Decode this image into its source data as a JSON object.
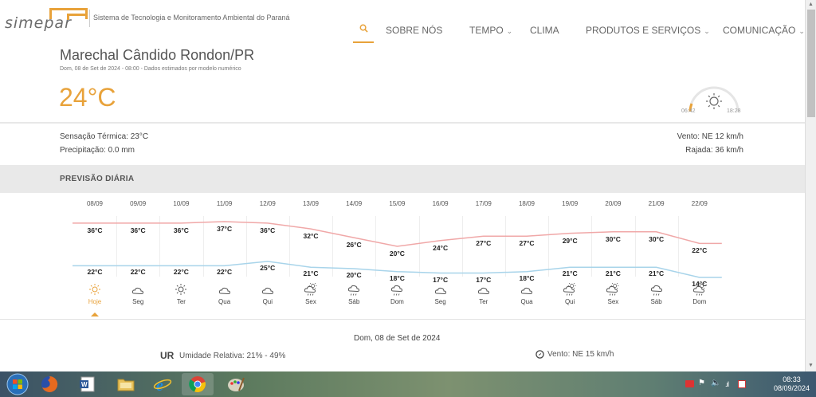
{
  "header": {
    "logo_text": "simepar",
    "subtitle": "Sistema de Tecnologia e Monitoramento Ambiental do Paraná",
    "nav": [
      {
        "label": "SOBRE NÓS",
        "dropdown": false
      },
      {
        "label": "TEMPO",
        "dropdown": true
      },
      {
        "label": "CLIMA",
        "dropdown": false
      },
      {
        "label": "PRODUTOS E SERVIÇOS",
        "dropdown": true
      },
      {
        "label": "COMUNICAÇÃO",
        "dropdown": true
      }
    ],
    "search_icon": "search-icon"
  },
  "current": {
    "city": "Marechal Cândido Rondon/PR",
    "date_note": "Dom, 08 de Set de 2024 - 08:00 - Dados estimados por modelo numérico",
    "temperature": "24°C",
    "sunrise": "06:42",
    "sunset": "18:28",
    "feels_like": "Sensação Térmica: 23°C",
    "precipitation": "Precipitação: 0.0 mm",
    "wind": "Vento: NE 12 km/h",
    "gust": "Rajada: 36 km/h"
  },
  "forecast": {
    "title": "PREVISÃO DIÁRIA",
    "days": [
      {
        "date": "08/09",
        "max": "36°C",
        "min": "22°C",
        "day": "Hoje",
        "icon": "sun-icon"
      },
      {
        "date": "09/09",
        "max": "36°C",
        "min": "22°C",
        "day": "Seg",
        "icon": "partly-cloudy-icon"
      },
      {
        "date": "10/09",
        "max": "36°C",
        "min": "22°C",
        "day": "Ter",
        "icon": "sun-icon"
      },
      {
        "date": "11/09",
        "max": "37°C",
        "min": "22°C",
        "day": "Qua",
        "icon": "partly-cloudy-icon"
      },
      {
        "date": "12/09",
        "max": "36°C",
        "min": "25°C",
        "day": "Qui",
        "icon": "partly-cloudy-icon"
      },
      {
        "date": "13/09",
        "max": "32°C",
        "min": "21°C",
        "day": "Sex",
        "icon": "sun-rain-icon"
      },
      {
        "date": "14/09",
        "max": "26°C",
        "min": "20°C",
        "day": "Sáb",
        "icon": "rain-icon"
      },
      {
        "date": "15/09",
        "max": "20°C",
        "min": "18°C",
        "day": "Dom",
        "icon": "rain-icon"
      },
      {
        "date": "16/09",
        "max": "24°C",
        "min": "17°C",
        "day": "Seg",
        "icon": "partly-cloudy-icon"
      },
      {
        "date": "17/09",
        "max": "27°C",
        "min": "17°C",
        "day": "Ter",
        "icon": "partly-cloudy-icon"
      },
      {
        "date": "18/09",
        "max": "27°C",
        "min": "18°C",
        "day": "Qua",
        "icon": "partly-cloudy-icon"
      },
      {
        "date": "19/09",
        "max": "29°C",
        "min": "21°C",
        "day": "Qui",
        "icon": "sun-rain-icon"
      },
      {
        "date": "20/09",
        "max": "30°C",
        "min": "21°C",
        "day": "Sex",
        "icon": "sun-rain-icon"
      },
      {
        "date": "21/09",
        "max": "30°C",
        "min": "21°C",
        "day": "Sáb",
        "icon": "rain-icon"
      },
      {
        "date": "22/09",
        "max": "22°C",
        "min": "14°C",
        "day": "Dom",
        "icon": "sun-rain-icon"
      }
    ]
  },
  "detail": {
    "date": "Dom, 08 de Set de 2024",
    "ur_label": "UR",
    "humidity": "Umidade Relativa: 21% - 49%",
    "wind": "Vento: NE 15 km/h"
  },
  "colors": {
    "accent": "#e8a23a",
    "max_line": "#f0a8a8",
    "min_line": "#a8d4ea"
  },
  "taskbar": {
    "apps": [
      "start-button",
      "firefox-icon",
      "word-icon",
      "file-explorer-icon",
      "internet-explorer-icon",
      "chrome-icon",
      "paint-icon"
    ],
    "time": "08:33",
    "date": "08/09/2024"
  }
}
